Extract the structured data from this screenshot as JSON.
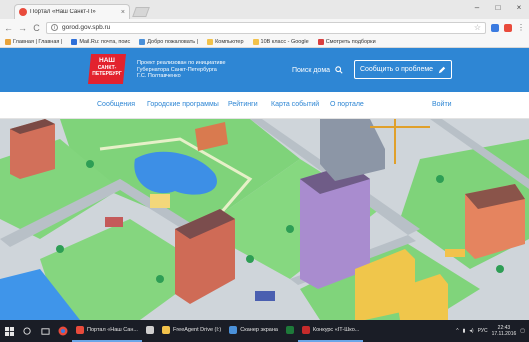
{
  "browser": {
    "tab_title": "Портал «Наш Санкт-П»",
    "tab_close": "×",
    "window_buttons": {
      "minimize": "–",
      "maximize": "□",
      "close": "×"
    },
    "nav": {
      "back": "←",
      "forward": "→",
      "reload": "C"
    },
    "url": "gorod.gov.spb.ru",
    "menu_glyph": "⋮",
    "bookmarks": [
      {
        "label": "Главная | Главная | ",
        "color": "#e8a33b"
      },
      {
        "label": "Mail.Ru: почта, поис",
        "color": "#2e6fd8"
      },
      {
        "label": "Добро пожаловать |",
        "color": "#4a90d9"
      },
      {
        "label": "Компьютер",
        "color": "#f2c24b"
      },
      {
        "label": "10В класс - Google ",
        "color": "#f2c24b"
      },
      {
        "label": "Смотреть подборки",
        "color": "#d93f3f"
      }
    ]
  },
  "site": {
    "logo_line1": "НАШ",
    "logo_line2": "САНКТ-ПЕТЕРБУРГ",
    "tagline": [
      "Проект реализован по инициативе",
      "Губернатора Санкт-Петербурга",
      "Г.С. Полтавченко"
    ],
    "search_label": "Поиск дома",
    "report_label": "Сообщить о проблеме",
    "nav": {
      "messages": "Сообщения",
      "programs": "Городские программы",
      "ratings": "Рейтинги",
      "events_map": "Карта событий",
      "about": "О портале",
      "login": "Войти"
    }
  },
  "taskbar": {
    "tasks": [
      {
        "label": "Портал «Наш Сан...",
        "color": "#e94b3c",
        "active": true
      },
      {
        "label": "",
        "color": "#cfcfcf",
        "active": false
      },
      {
        "label": "FreeAgent Drive (I:)",
        "color": "#f2c24b",
        "active": false
      },
      {
        "label": "Сканер экрана",
        "color": "#4a90d9",
        "active": false
      },
      {
        "label": "",
        "color": "#1e7a3a",
        "active": false
      },
      {
        "label": "Конкурс «IT-Шко...",
        "color": "#c62b2b",
        "active": true
      }
    ],
    "lang": "РУС",
    "time": "22:43",
    "date": "17.11.2016"
  }
}
